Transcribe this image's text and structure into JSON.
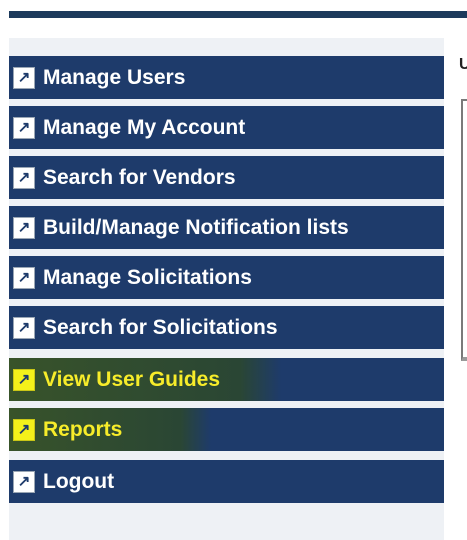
{
  "nav": {
    "items": [
      {
        "label": "Manage Users",
        "icon": "external-link-arrow-icon"
      },
      {
        "label": "Manage My Account",
        "icon": "external-link-arrow-icon"
      },
      {
        "label": "Search for Vendors",
        "icon": "external-link-arrow-icon"
      },
      {
        "label": "Build/Manage Notification lists",
        "icon": "external-link-arrow-icon"
      },
      {
        "label": "Manage Solicitations",
        "icon": "external-link-arrow-icon"
      },
      {
        "label": "Search for Solicitations",
        "icon": "external-link-arrow-icon"
      },
      {
        "label": "View User Guides",
        "icon": "external-link-arrow-icon",
        "highlighted": true
      },
      {
        "label": "Reports",
        "icon": "external-link-arrow-icon",
        "highlighted": true
      },
      {
        "label": "Logout",
        "icon": "external-link-arrow-icon"
      }
    ],
    "arrow_glyph": "↗"
  },
  "main": {
    "title_fragment": "U"
  },
  "colors": {
    "nav_bg": "#1e3b6b",
    "highlight": "#f4f11a",
    "top_bar": "#1c3a5c"
  }
}
